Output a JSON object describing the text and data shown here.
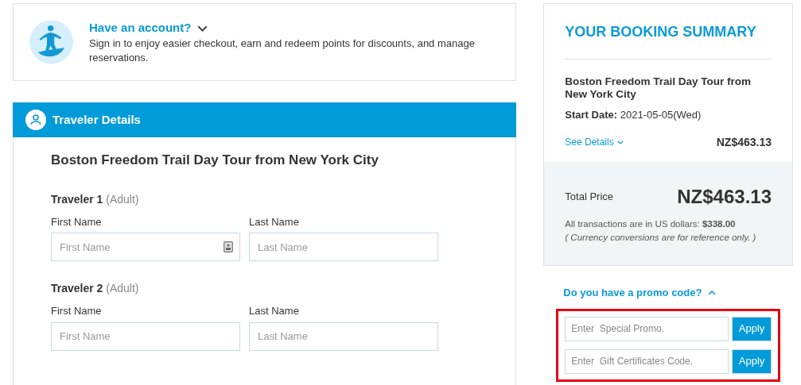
{
  "account": {
    "title": "Have an account?",
    "expanded": false,
    "text": "Sign in to enjoy easier checkout, earn and redeem points for discounts, and manage reservations."
  },
  "traveler_details": {
    "title": "Traveler Details",
    "tour": "Boston Freedom Trail Day Tour from New York City",
    "travelers": [
      {
        "label": "Traveler 1",
        "type": "(Adult)",
        "fields": [
          {
            "label": "First Name",
            "placeholder": "First Name",
            "contact_icon": true
          },
          {
            "label": "Last Name",
            "placeholder": "Last Name",
            "contact_icon": false
          }
        ]
      },
      {
        "label": "Traveler 2",
        "type": "(Adult)",
        "fields": [
          {
            "label": "First Name",
            "placeholder": "First Name",
            "contact_icon": false
          },
          {
            "label": "Last Name",
            "placeholder": "Last Name",
            "contact_icon": false
          }
        ]
      }
    ]
  },
  "summary": {
    "title": "YOUR BOOKING SUMMARY",
    "tour": "Boston Freedom Trail Day Tour from New York City",
    "start_label": "Start Date:",
    "start_date": "2021-05-05(Wed)",
    "details_link": "See Details",
    "details_expanded": false,
    "price": "NZ$463.13",
    "total_label": "Total Price",
    "total": "NZ$463.13",
    "usd_note": "All transactions are in US dollars: **$338.00**",
    "conversion_note": "( Currency conversions are for reference only. )"
  },
  "promo": {
    "title": "Do you have a promo code?",
    "expanded": true,
    "highlighted": true,
    "fields": [
      {
        "placeholder": "Enter  Special Promo.",
        "button": "Apply"
      },
      {
        "placeholder": "Enter  Gift Certificates Code.",
        "button": "Apply"
      }
    ]
  }
}
